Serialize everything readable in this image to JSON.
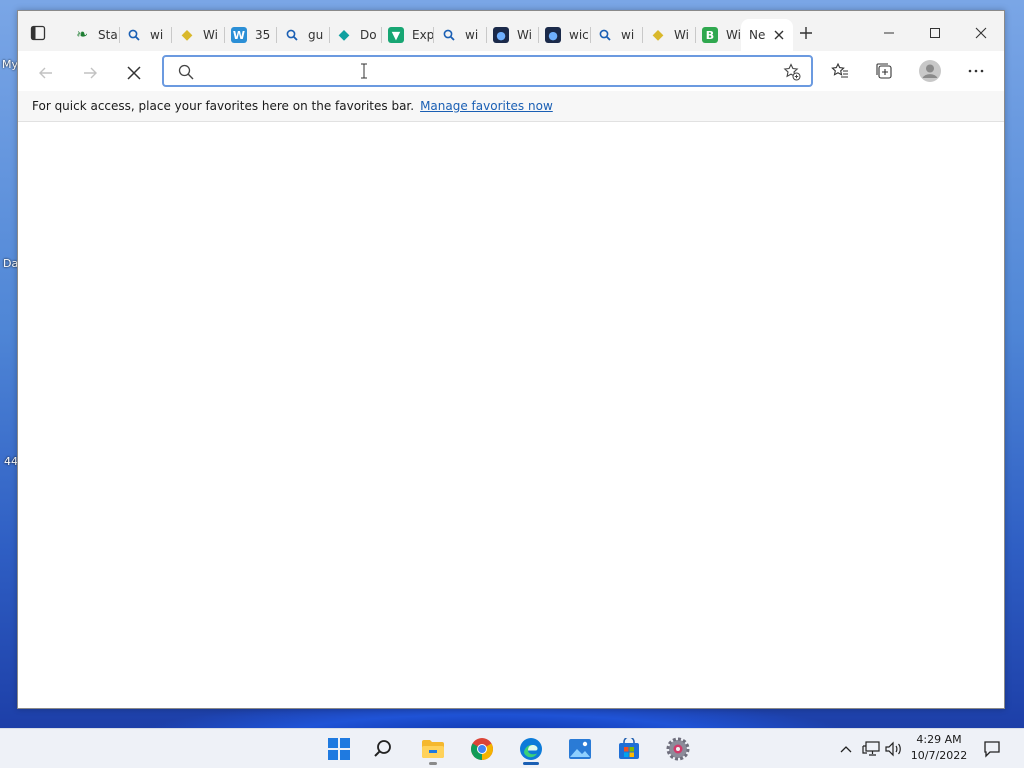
{
  "desktop": {
    "labels": [
      "My",
      "Da",
      "44"
    ]
  },
  "browser": {
    "tabs": [
      {
        "title": "Sta",
        "icon": "leaf-icon",
        "color": "#1e7d32"
      },
      {
        "title": "wi",
        "icon": "search-icon",
        "color": "#1a5fb4"
      },
      {
        "title": "Wi",
        "icon": "python-icon",
        "color": "#d9b82b"
      },
      {
        "title": "35",
        "icon": "w-icon",
        "color": "#2b8fd6"
      },
      {
        "title": "gu",
        "icon": "search-icon",
        "color": "#1a5fb4"
      },
      {
        "title": "Do",
        "icon": "gem-icon",
        "color": "#0fa0a0"
      },
      {
        "title": "Exp",
        "icon": "vpn-icon",
        "color": "#17a673"
      },
      {
        "title": "wi",
        "icon": "search-icon",
        "color": "#1a5fb4"
      },
      {
        "title": "Wi",
        "icon": "lens-icon",
        "color": "#1b2a4a"
      },
      {
        "title": "wic",
        "icon": "lens-icon",
        "color": "#1b2a4a"
      },
      {
        "title": "wi",
        "icon": "search-icon",
        "color": "#1a5fb4"
      },
      {
        "title": "Wi",
        "icon": "python-icon",
        "color": "#d9b82b"
      },
      {
        "title": "Wi",
        "icon": "b-icon",
        "color": "#2fa84f"
      },
      {
        "title": "Ne",
        "icon": "",
        "color": "#ffffff",
        "active": true
      }
    ],
    "address": {
      "value": "",
      "placeholder": ""
    },
    "favorites_bar": {
      "text": "For quick access, place your favorites here on the favorites bar.",
      "link": "Manage favorites now"
    },
    "accent_color": "#1a5fb4"
  },
  "taskbar": {
    "apps": [
      "start-icon",
      "search-icon",
      "file-explorer-icon",
      "chrome-icon",
      "edge-icon",
      "photos-icon",
      "store-icon",
      "settings-icon"
    ],
    "clock": {
      "time": "4:29 AM",
      "date": "10/7/2022"
    }
  }
}
